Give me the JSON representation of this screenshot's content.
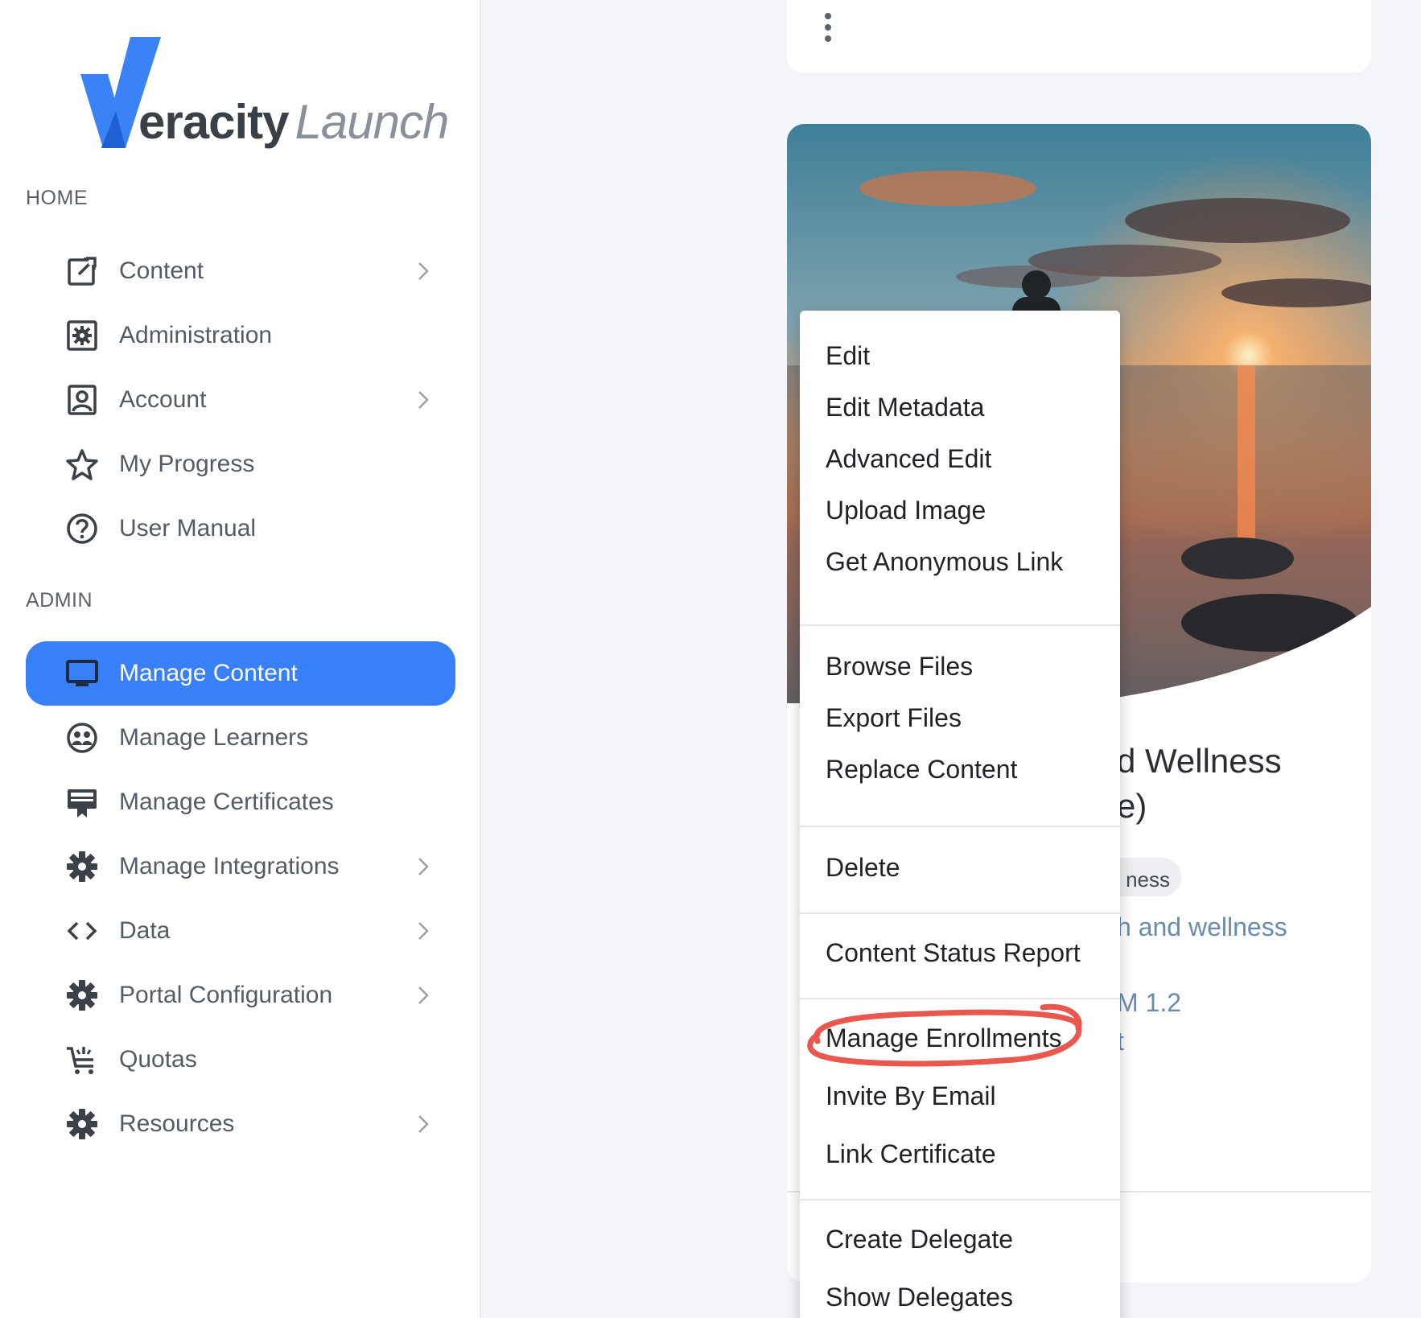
{
  "brand": {
    "part1": "eracity",
    "part2": "Launch"
  },
  "sidebar": {
    "home_title": "HOME",
    "admin_title": "ADMIN",
    "home_items": [
      {
        "label": "Content",
        "icon": "external-edit-icon",
        "has_chevron": true
      },
      {
        "label": "Administration",
        "icon": "admin-gear-icon",
        "has_chevron": false
      },
      {
        "label": "Account",
        "icon": "account-icon",
        "has_chevron": true
      },
      {
        "label": "My Progress",
        "icon": "star-icon",
        "has_chevron": false
      },
      {
        "label": "User Manual",
        "icon": "help-icon",
        "has_chevron": false
      }
    ],
    "admin_items": [
      {
        "label": "Manage Content",
        "icon": "monitor-icon",
        "active": true
      },
      {
        "label": "Manage Learners",
        "icon": "learners-icon"
      },
      {
        "label": "Manage Certificates",
        "icon": "certificate-icon"
      },
      {
        "label": "Manage Integrations",
        "icon": "gear-icon",
        "has_chevron": true
      },
      {
        "label": "Data",
        "icon": "code-icon",
        "has_chevron": true
      },
      {
        "label": "Portal Configuration",
        "icon": "gear-icon",
        "has_chevron": true
      },
      {
        "label": "Quotas",
        "icon": "cart-icon"
      },
      {
        "label": "Resources",
        "icon": "gear-icon",
        "has_chevron": true
      }
    ]
  },
  "card": {
    "title_line1": "d Wellness",
    "title_line2": "e)",
    "tag": "ness",
    "description": "h and wellness",
    "meta1": "M 1.2",
    "meta2": "t"
  },
  "menu": {
    "items": [
      "Edit",
      "Edit Metadata",
      "Advanced Edit",
      "Upload Image",
      "Get Anonymous Link",
      "Browse Files",
      "Export Files",
      "Replace Content",
      "Delete",
      "Content Status Report",
      "Manage Enrollments",
      "Invite By Email",
      "Link Certificate",
      "Create Delegate",
      "Show Delegates"
    ],
    "highlighted": "Manage Enrollments"
  },
  "colors": {
    "accent": "#3880f7",
    "highlight_ring": "#e8584f",
    "link_text": "#6a8bb0"
  }
}
